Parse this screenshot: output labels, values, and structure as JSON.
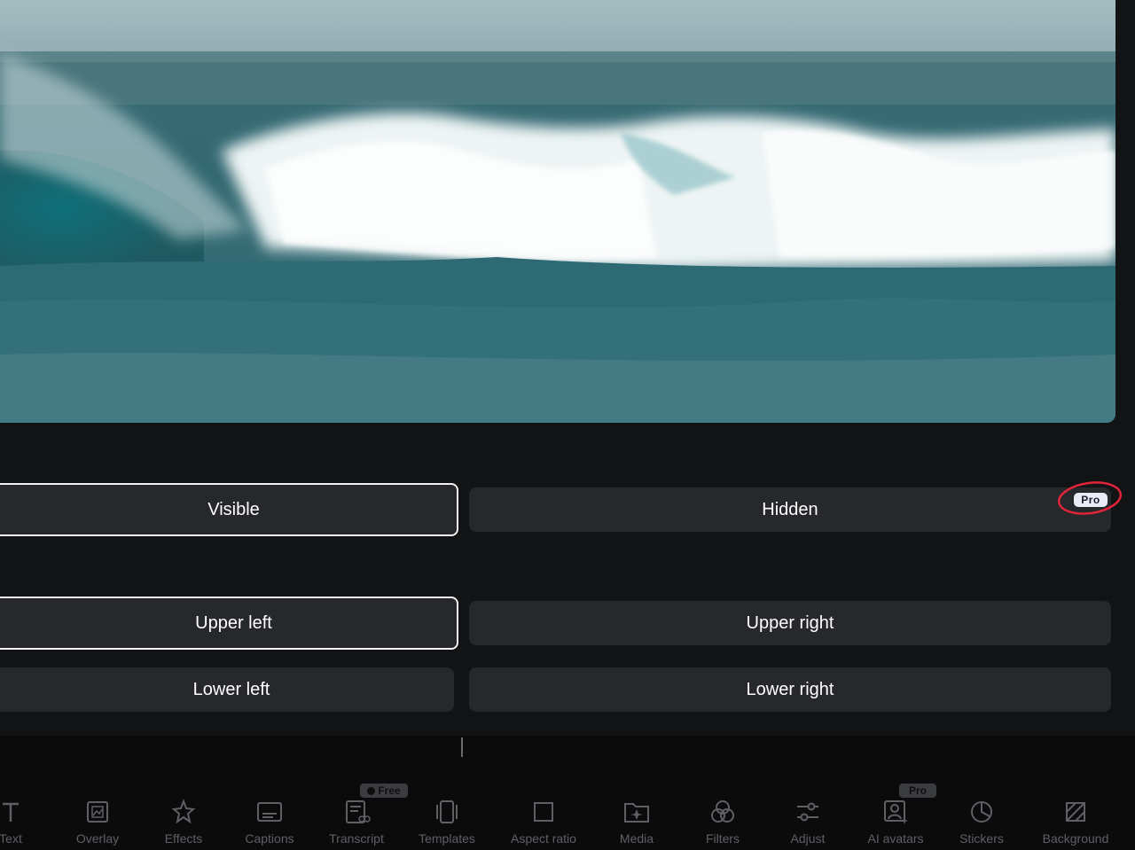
{
  "visibility": {
    "visible_label": "Visible",
    "hidden_label": "Hidden",
    "hidden_badge": "Pro"
  },
  "position": {
    "upper_left": "Upper left",
    "upper_right": "Upper right",
    "lower_left": "Lower left",
    "lower_right": "Lower right"
  },
  "toolbar": {
    "items": [
      {
        "label": "Text",
        "icon": "text-icon"
      },
      {
        "label": "Overlay",
        "icon": "overlay-icon"
      },
      {
        "label": "Effects",
        "icon": "effects-icon"
      },
      {
        "label": "Captions",
        "icon": "captions-icon"
      },
      {
        "label": "Transcript",
        "icon": "transcript-icon",
        "badge": "Free"
      },
      {
        "label": "Templates",
        "icon": "templates-icon"
      },
      {
        "label": "Aspect ratio",
        "icon": "aspect-ratio-icon"
      },
      {
        "label": "Media",
        "icon": "media-icon"
      },
      {
        "label": "Filters",
        "icon": "filters-icon"
      },
      {
        "label": "Adjust",
        "icon": "adjust-icon"
      },
      {
        "label": "AI avatars",
        "icon": "ai-avatars-icon",
        "badge": "Pro"
      },
      {
        "label": "Stickers",
        "icon": "stickers-icon"
      },
      {
        "label": "Background",
        "icon": "background-icon"
      }
    ]
  },
  "colors": {
    "background": "#121314",
    "button": "#26282b",
    "selected_border": "#f2f2f2",
    "annotation_ring": "#e0243a"
  }
}
